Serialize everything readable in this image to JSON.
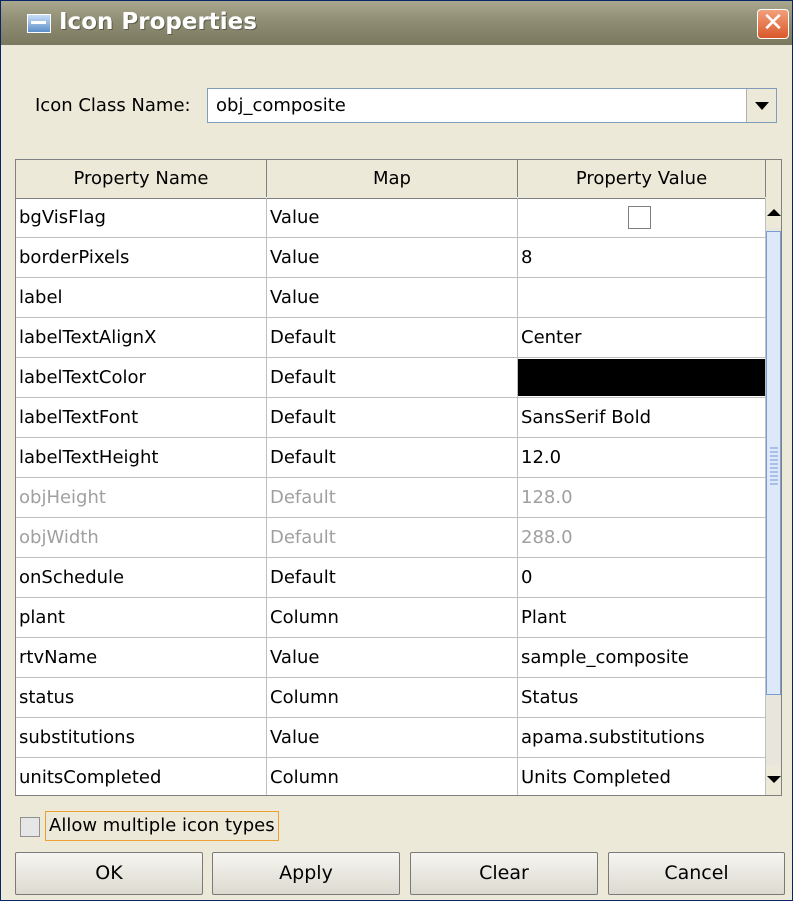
{
  "window": {
    "title": "Icon Properties",
    "close_symbol": "✕"
  },
  "class_name": {
    "label": "Icon Class Name:",
    "value": "obj_composite"
  },
  "table": {
    "headers": [
      "Property Name",
      "Map",
      "Property Value"
    ],
    "rows": [
      {
        "name": "bgVisFlag",
        "map": "Value",
        "value": "",
        "kind": "checkbox",
        "checked": false
      },
      {
        "name": "borderPixels",
        "map": "Value",
        "value": "8"
      },
      {
        "name": "label",
        "map": "Value",
        "value": ""
      },
      {
        "name": "labelTextAlignX",
        "map": "Default",
        "value": "Center"
      },
      {
        "name": "labelTextColor",
        "map": "Default",
        "value": "",
        "kind": "color",
        "color": "#000000"
      },
      {
        "name": "labelTextFont",
        "map": "Default",
        "value": "SansSerif Bold"
      },
      {
        "name": "labelTextHeight",
        "map": "Default",
        "value": "12.0"
      },
      {
        "name": "objHeight",
        "map": "Default",
        "value": "128.0",
        "disabled": true
      },
      {
        "name": "objWidth",
        "map": "Default",
        "value": "288.0",
        "disabled": true
      },
      {
        "name": "onSchedule",
        "map": "Default",
        "value": "0"
      },
      {
        "name": "plant",
        "map": "Column",
        "value": "Plant"
      },
      {
        "name": "rtvName",
        "map": "Value",
        "value": "sample_composite"
      },
      {
        "name": "status",
        "map": "Column",
        "value": "Status"
      },
      {
        "name": "substitutions",
        "map": "Value",
        "value": "apama.substitutions"
      },
      {
        "name": "unitsCompleted",
        "map": "Column",
        "value": "Units Completed"
      }
    ]
  },
  "allow_multiple": {
    "label": "Allow multiple icon types",
    "checked": false
  },
  "buttons": {
    "ok": "OK",
    "apply": "Apply",
    "clear": "Clear",
    "cancel": "Cancel"
  },
  "colors": {
    "title_bar": "#8f8e74",
    "dialog_bg": "#ece9d8",
    "close_button": "#d9582a",
    "focus_border": "#f0a030"
  }
}
